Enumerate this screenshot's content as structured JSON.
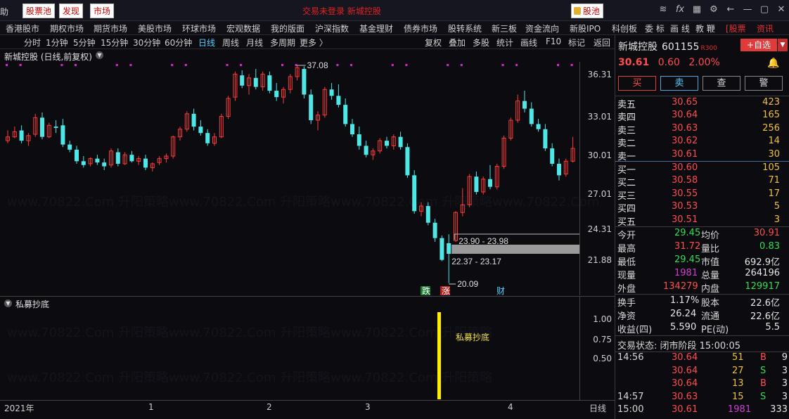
{
  "top": {
    "help": "助",
    "buttons": [
      "股票池",
      "发现",
      "市场"
    ],
    "center_text": "交易未登录 新城控股",
    "pool_btn": "股池"
  },
  "menu": [
    "香港股市",
    "期权市场",
    "期货市场",
    "美股市场",
    "环球市场",
    "宏观数据",
    "我的版面",
    "沪深指数",
    "基金理财",
    "债券市场",
    "股转系统",
    "新三板",
    "资金流向",
    "新股IPO",
    "科创板",
    "委 标",
    "画 线",
    "教 鞭",
    "[股票",
    "资讯"
  ],
  "periods": [
    "分时",
    "1分钟",
    "5分钟",
    "15分钟",
    "30分钟",
    "60分钟",
    "日线",
    "周线",
    "月线",
    "多周期",
    "更多 〉"
  ],
  "selected_period": "日线",
  "tools": [
    "复权",
    "叠加",
    "多股",
    "统计",
    "画线",
    "F10",
    "标记",
    "返回"
  ],
  "chart_title": "新城控股 (日线,前复权)",
  "chart_data": {
    "type": "candlestick",
    "y_ticks": [
      "36.31",
      "33.01",
      "30.01",
      "27.01",
      "24.31",
      "21.88"
    ],
    "annotations": [
      "37.08",
      "23.90 - 23.98",
      "22.37 - 23.17",
      "20.09"
    ],
    "tags": [
      "跌",
      "涨",
      "财"
    ],
    "ohlc": [
      [
        31.2,
        32.0,
        31.0,
        31.5
      ],
      [
        31.5,
        32.3,
        31.4,
        31.9
      ],
      [
        32.0,
        32.4,
        31.0,
        31.2
      ],
      [
        31.2,
        31.8,
        30.8,
        31.6
      ],
      [
        31.7,
        33.3,
        31.5,
        33.0
      ],
      [
        33.0,
        33.4,
        31.3,
        31.5
      ],
      [
        31.5,
        32.6,
        31.4,
        32.4
      ],
      [
        32.3,
        32.8,
        31.8,
        32.2
      ],
      [
        32.4,
        32.9,
        30.7,
        30.9
      ],
      [
        30.9,
        31.2,
        30.3,
        30.5
      ],
      [
        30.5,
        30.8,
        29.4,
        29.6
      ],
      [
        29.6,
        30.0,
        29.1,
        29.3
      ],
      [
        29.4,
        29.9,
        29.2,
        29.8
      ],
      [
        29.8,
        30.1,
        29.3,
        29.5
      ],
      [
        29.5,
        29.8,
        28.9,
        29.2
      ],
      [
        29.3,
        30.6,
        29.1,
        30.4
      ],
      [
        30.3,
        30.6,
        29.2,
        29.4
      ],
      [
        29.4,
        30.3,
        29.3,
        30.1
      ],
      [
        30.1,
        30.4,
        29.5,
        29.6
      ],
      [
        29.6,
        30.0,
        29.3,
        29.8
      ],
      [
        29.8,
        30.1,
        28.9,
        29.1
      ],
      [
        29.1,
        29.5,
        28.8,
        29.4
      ],
      [
        29.5,
        30.0,
        29.3,
        29.8
      ],
      [
        29.8,
        30.2,
        29.5,
        30.0
      ],
      [
        30.0,
        31.6,
        29.8,
        31.5
      ],
      [
        31.5,
        32.3,
        31.2,
        32.1
      ],
      [
        32.1,
        33.5,
        31.9,
        33.3
      ],
      [
        33.3,
        33.7,
        32.0,
        32.3
      ],
      [
        32.3,
        32.8,
        31.6,
        31.8
      ],
      [
        31.8,
        32.1,
        30.8,
        31.0
      ],
      [
        31.0,
        31.8,
        30.8,
        31.5
      ],
      [
        31.5,
        33.3,
        31.4,
        33.1
      ],
      [
        33.1,
        34.7,
        32.9,
        34.5
      ],
      [
        34.6,
        36.6,
        34.3,
        36.4
      ],
      [
        36.3,
        36.7,
        35.3,
        35.5
      ],
      [
        35.5,
        36.4,
        34.8,
        36.1
      ],
      [
        36.1,
        36.8,
        35.2,
        35.4
      ],
      [
        35.4,
        36.6,
        35.1,
        36.4
      ],
      [
        36.3,
        36.6,
        34.9,
        35.1
      ],
      [
        35.1,
        35.7,
        34.3,
        34.6
      ],
      [
        34.6,
        35.4,
        34.1,
        35.2
      ],
      [
        35.2,
        36.4,
        34.9,
        36.2
      ],
      [
        36.2,
        37.1,
        35.9,
        36.9
      ],
      [
        36.8,
        37.0,
        34.5,
        34.8
      ],
      [
        34.8,
        35.2,
        32.5,
        32.8
      ],
      [
        32.8,
        33.5,
        32.0,
        33.2
      ],
      [
        33.2,
        35.4,
        33.0,
        35.2
      ],
      [
        35.2,
        35.7,
        34.4,
        34.7
      ],
      [
        34.7,
        35.6,
        33.8,
        34.0
      ],
      [
        34.0,
        34.5,
        32.3,
        32.5
      ],
      [
        32.5,
        32.9,
        31.5,
        31.7
      ],
      [
        31.7,
        32.3,
        30.5,
        30.8
      ],
      [
        30.8,
        31.2,
        29.9,
        30.1
      ],
      [
        30.1,
        30.6,
        29.7,
        30.4
      ],
      [
        30.4,
        31.4,
        30.2,
        31.2
      ],
      [
        31.2,
        31.5,
        30.6,
        30.8
      ],
      [
        30.8,
        31.7,
        30.5,
        31.5
      ],
      [
        31.5,
        31.9,
        30.5,
        30.7
      ],
      [
        30.7,
        31.0,
        28.3,
        28.5
      ],
      [
        28.5,
        28.9,
        25.5,
        25.7
      ],
      [
        25.7,
        26.4,
        25.3,
        26.1
      ],
      [
        26.1,
        26.4,
        24.6,
        24.8
      ],
      [
        24.8,
        25.1,
        23.3,
        23.6
      ],
      [
        23.6,
        23.8,
        21.8,
        21.9
      ],
      [
        23.2,
        23.9,
        20.09,
        22.37
      ],
      [
        23.4,
        25.7,
        23.3,
        25.6
      ],
      [
        25.6,
        27.5,
        25.3,
        26.2
      ],
      [
        26.2,
        28.6,
        26.0,
        28.4
      ],
      [
        28.4,
        28.8,
        27.0,
        27.2
      ],
      [
        27.2,
        28.4,
        27.0,
        28.2
      ],
      [
        28.2,
        29.3,
        27.4,
        27.6
      ],
      [
        27.6,
        29.4,
        27.4,
        29.2
      ],
      [
        29.2,
        31.6,
        29.0,
        31.4
      ],
      [
        31.4,
        33.0,
        31.2,
        32.8
      ],
      [
        32.8,
        34.8,
        32.6,
        34.3
      ],
      [
        34.3,
        35.1,
        33.4,
        33.7
      ],
      [
        33.7,
        34.2,
        32.3,
        32.5
      ],
      [
        32.5,
        32.9,
        31.9,
        32.1
      ],
      [
        32.1,
        32.5,
        30.4,
        30.6
      ],
      [
        30.6,
        31.0,
        29.2,
        29.4
      ],
      [
        29.4,
        29.8,
        28.1,
        28.5
      ],
      [
        28.6,
        29.8,
        28.4,
        29.6
      ],
      [
        29.6,
        31.5,
        29.5,
        30.6
      ]
    ],
    "indicator": {
      "name": "私募抄底",
      "y_ticks": [
        "1.00",
        "0.75",
        "0.50"
      ],
      "signal_label": "私募抄底"
    },
    "x_labels": [
      "2021年",
      "1",
      "2",
      "3",
      "4"
    ],
    "period_label": "日线"
  },
  "panel": {
    "name": "新城控股",
    "code": "601155",
    "r_tag": "R",
    "r_tag_num": "300",
    "add_btn": "+自选",
    "price": "30.61",
    "change": "0.60",
    "pct": "2.00%",
    "trade_buttons": [
      "买",
      "卖",
      "查",
      "警"
    ],
    "asks": [
      {
        "label": "卖五",
        "price": "30.65",
        "vol": "423"
      },
      {
        "label": "卖四",
        "price": "30.64",
        "vol": "165"
      },
      {
        "label": "卖三",
        "price": "30.63",
        "vol": "256"
      },
      {
        "label": "卖二",
        "price": "30.62",
        "vol": "14"
      },
      {
        "label": "卖一",
        "price": "30.61",
        "vol": "30"
      }
    ],
    "bids": [
      {
        "label": "买一",
        "price": "30.60",
        "vol": "105"
      },
      {
        "label": "买二",
        "price": "30.58",
        "vol": "71"
      },
      {
        "label": "买三",
        "price": "30.55",
        "vol": "17"
      },
      {
        "label": "买四",
        "price": "30.53",
        "vol": "5"
      },
      {
        "label": "买五",
        "price": "30.51",
        "vol": "3"
      }
    ],
    "stats": [
      {
        "l1": "今开",
        "v1": "29.45",
        "l2": "均价",
        "v2": "30.91"
      },
      {
        "l1": "最高",
        "v1": "31.72",
        "l2": "量比",
        "v2": "0.83"
      },
      {
        "l1": "最低",
        "v1": "29.45",
        "l2": "市值",
        "v2": "692.9亿"
      },
      {
        "l1": "现量",
        "v1": "1981",
        "l2": "总量",
        "v2": "264196"
      },
      {
        "l1": "外盘",
        "v1": "134279",
        "l2": "内盘",
        "v2": "129917"
      }
    ],
    "stats2": [
      {
        "l1": "换手",
        "v1": "1.17%",
        "l2": "股本",
        "v2": "22.6亿"
      },
      {
        "l1": "净资",
        "v1": "26.24",
        "l2": "流通",
        "v2": "22.6亿"
      },
      {
        "l1": "收益(四)",
        "v1": "5.590",
        "l2": "PE(动)",
        "v2": "5.5"
      }
    ],
    "status": "交易状态: 闭市阶段 15:00:05",
    "ticks": [
      {
        "time": "14:56",
        "price": "30.64",
        "vol": "51",
        "side": "B",
        "n": "9"
      },
      {
        "time": "",
        "price": "30.64",
        "vol": "27",
        "side": "S",
        "n": "3"
      },
      {
        "time": "",
        "price": "30.64",
        "vol": "13",
        "side": "B",
        "n": "3"
      },
      {
        "time": "14:57",
        "price": "30.63",
        "vol": "15",
        "side": "S",
        "n": "3"
      },
      {
        "time": "15:00",
        "price": "30.61",
        "vol": "1981",
        "side": "",
        "n": "333"
      }
    ]
  }
}
